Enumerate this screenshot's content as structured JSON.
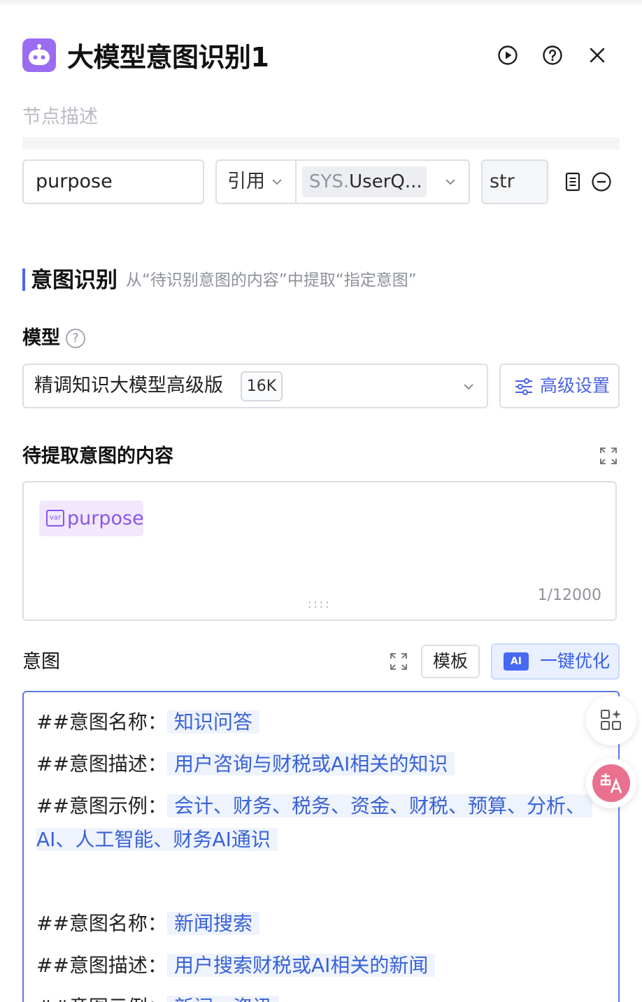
{
  "header": {
    "title": "大模型意图识别1",
    "node_description_placeholder": "节点描述"
  },
  "input_row": {
    "param_name": "purpose",
    "source_type": "引用",
    "variable_prefix": "SYS.",
    "variable_value": "UserQ...",
    "data_type": "str"
  },
  "section": {
    "title": "意图识别",
    "subtitle": "从“待识别意图的内容”中提取“指定意图”"
  },
  "model": {
    "label": "模型",
    "help": "?",
    "selected": "精调知识大模型高级版",
    "context_badge": "16K",
    "advanced_settings": "高级设置"
  },
  "content": {
    "label": "待提取意图的内容",
    "variable_tag": "purpose",
    "variable_icon_text": "var",
    "counter": "1/12000",
    "drag_handle": "::::"
  },
  "intent": {
    "label": "意图",
    "template_button": "模板",
    "ai_badge": "AI",
    "optimize_button": "一键优化",
    "lines": [
      {
        "prefix": "##意图名称：",
        "value": "知识问答"
      },
      {
        "prefix": "##意图描述：",
        "value": "用户咨询与财税或AI相关的知识"
      },
      {
        "prefix": "##意图示例：",
        "value": "会计、财务、税务、资金、财税、预算、分析、"
      },
      {
        "prefix": "",
        "value": "AI、人工智能、财务AI通识"
      },
      {
        "prefix": "##意图名称：",
        "value": "新闻搜索"
      },
      {
        "prefix": "##意图描述：",
        "value": "用户搜索财税或AI相关的新闻"
      },
      {
        "prefix": "##意图示例：",
        "value": "新闻、资讯"
      }
    ]
  },
  "colors": {
    "accent": "#4d66e8",
    "brand_purple": "#9b6cf2",
    "highlight_text": "#3a62d6"
  }
}
